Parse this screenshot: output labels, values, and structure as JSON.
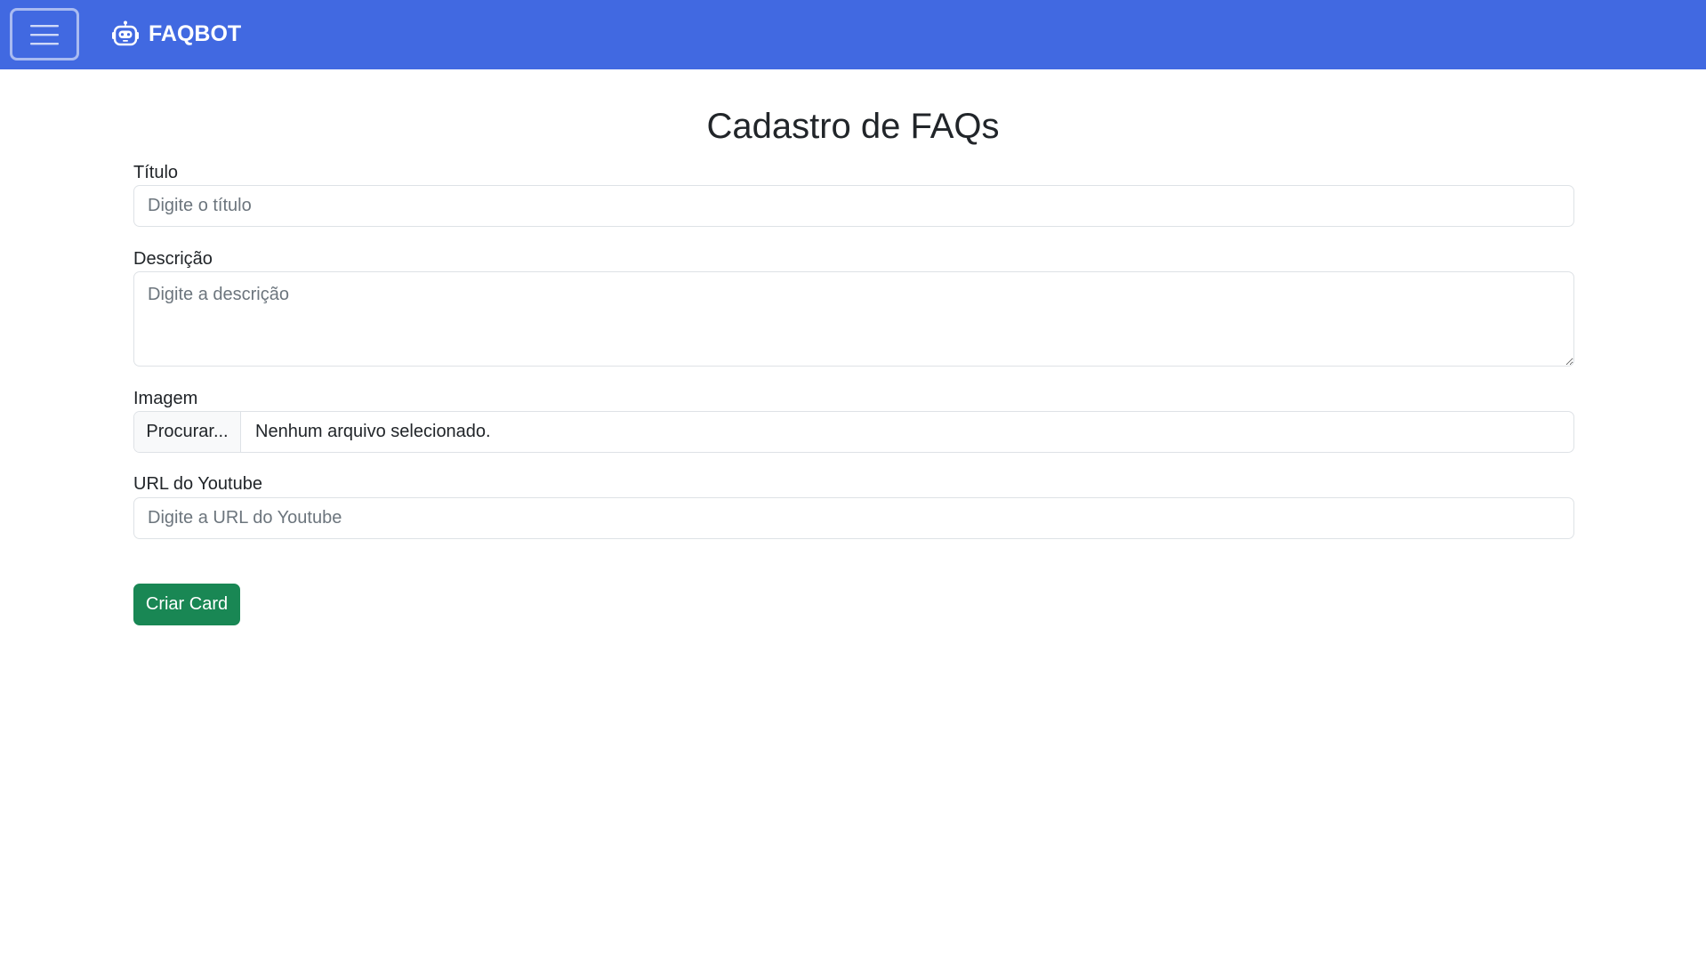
{
  "navbar": {
    "toggler_icon": "hamburger-icon",
    "brand_icon": "robot-icon",
    "brand_text": "FAQBOT",
    "background": "#4169e1"
  },
  "page": {
    "title": "Cadastro de FAQs"
  },
  "form": {
    "titulo": {
      "label": "Título",
      "placeholder": "Digite o título",
      "value": ""
    },
    "descricao": {
      "label": "Descrição",
      "placeholder": "Digite a descrição",
      "value": ""
    },
    "imagem": {
      "label": "Imagem",
      "button_label": "Procurar...",
      "file_status": "Nenhum arquivo selecionado."
    },
    "youtube": {
      "label": "URL do Youtube",
      "placeholder": "Digite a URL do Youtube",
      "value": ""
    },
    "submit_label": "Criar Card",
    "submit_color": "#198754"
  }
}
